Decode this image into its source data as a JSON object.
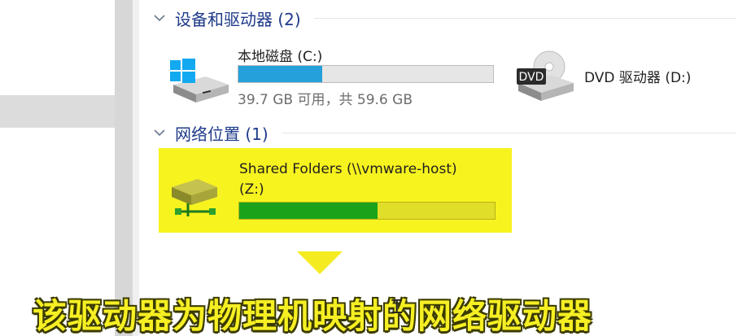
{
  "groups": {
    "devices": {
      "title": "设备和驱动器 (2)"
    },
    "network": {
      "title": "网络位置 (1)"
    }
  },
  "drives": {
    "c": {
      "name": "本地磁盘 (C:)",
      "usage": "39.7 GB 可用，共 59.6 GB",
      "used_fraction": 0.33
    },
    "d": {
      "name": "DVD 驱动器 (D:)",
      "icon_label": "DVD"
    },
    "z": {
      "name_line1": "Shared Folders (\\\\vmware-host)",
      "name_line2": "(Z:)",
      "used_fraction": 0.54
    }
  },
  "caption": {
    "text": "该驱动器为物理机映射的网络驱动器"
  },
  "colors": {
    "bar_fill_c": "#26a0da",
    "bar_fill_z": "#1aa31a",
    "highlight": "#f7f31f",
    "group_title": "#1e3a8a"
  }
}
